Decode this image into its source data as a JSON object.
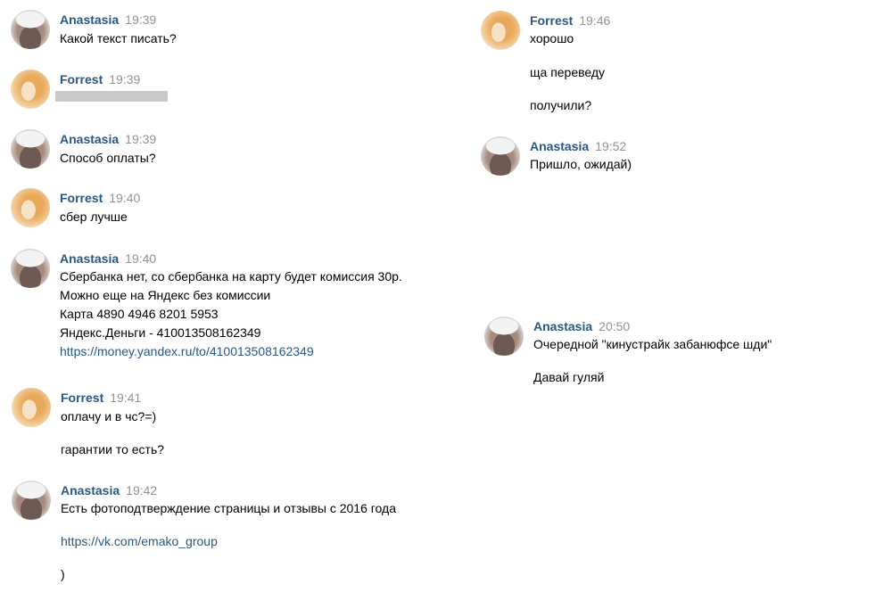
{
  "messages": [
    {
      "author": "Anastasia",
      "time": "19:39",
      "lines": [
        "Какой текст писать?"
      ]
    },
    {
      "author": "Forrest",
      "time": "19:39",
      "lines": []
    },
    {
      "author": "Anastasia",
      "time": "19:39",
      "lines": [
        "Способ оплаты?"
      ]
    },
    {
      "author": "Forrest",
      "time": "19:40",
      "lines": [
        "сбер лучше"
      ]
    },
    {
      "author": "Anastasia",
      "time": "19:40",
      "lines": [
        "Сбербанка нет, со сбербанка на карту будет комиссия 30р.",
        "Можно еще на Яндекс без комиссии",
        "Карта 4890 4946 8201 5953",
        "Яндекс.Деньги - 410013508162349",
        "https://money.yandex.ru/to/410013508162349"
      ]
    },
    {
      "author": "Forrest",
      "time": "19:41",
      "lines": [
        "оплачу и в чс?=)",
        "гарантии то есть?"
      ]
    },
    {
      "author": "Anastasia",
      "time": "19:42",
      "lines": [
        "Есть фотоподтверждение страницы и отзывы с 2016 года",
        "https://vk.com/emako_group",
        ")"
      ]
    },
    {
      "author": "Forrest",
      "time": "19:46",
      "lines": [
        "хорошо",
        "ща переведу",
        "получили?"
      ]
    },
    {
      "author": "Anastasia",
      "time": "19:52",
      "lines": [
        "Пришло, ожидай)"
      ]
    },
    {
      "author": "Anastasia",
      "time": "20:50",
      "lines": [
        "Очередной \"кинустрайк забанюфсе шди\"",
        "Давай гуляй"
      ]
    }
  ],
  "colors": {
    "name": "#2a5885",
    "time": "#939393",
    "link": "#2a5885",
    "text": "#000000"
  }
}
